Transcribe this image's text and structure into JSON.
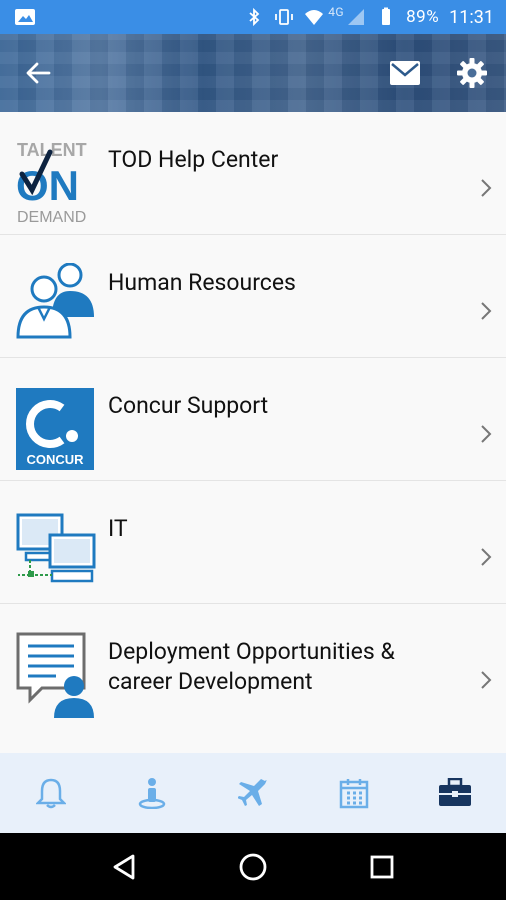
{
  "status_bar": {
    "network": "4G",
    "battery": "89%",
    "time": "11:31"
  },
  "header": {
    "back_icon": "back-arrow-icon",
    "mail_icon": "mail-icon",
    "settings_icon": "gear-icon"
  },
  "tod_logo": {
    "line1": "TALENT",
    "line2": "ON",
    "line3": "DEMAND"
  },
  "concur_logo": {
    "text": "CONCUR"
  },
  "list": {
    "items": [
      {
        "label": "TOD Help Center",
        "icon": "talent-on-demand-logo"
      },
      {
        "label": "Human Resources",
        "icon": "people-icon"
      },
      {
        "label": "Concur Support",
        "icon": "concur-logo"
      },
      {
        "label": "IT",
        "icon": "computers-icon"
      },
      {
        "label": "Deployment Opportunities & career Development",
        "icon": "career-chat-icon"
      }
    ]
  },
  "bottom_nav": {
    "items": [
      {
        "icon": "bell-icon",
        "active": false
      },
      {
        "icon": "person-location-icon",
        "active": false
      },
      {
        "icon": "airplane-icon",
        "active": false
      },
      {
        "icon": "calendar-icon",
        "active": false
      },
      {
        "icon": "briefcase-icon",
        "active": true
      }
    ],
    "active_color": "#17355f",
    "inactive_color": "#6aaee8"
  },
  "colors": {
    "status_bar": "#3a8ee6",
    "accent_blue": "#1f7ac0"
  }
}
